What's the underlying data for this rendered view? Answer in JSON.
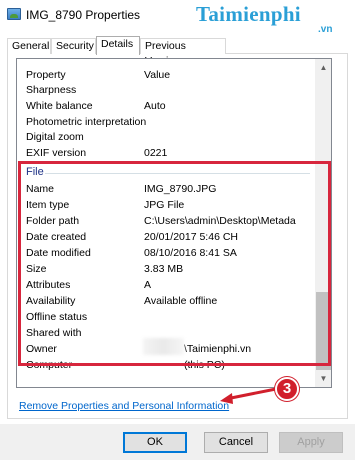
{
  "window": {
    "title": "IMG_8790 Properties",
    "watermark": "Taimienphi",
    "watermark_sub": ".vn"
  },
  "tabs": [
    {
      "label": "General"
    },
    {
      "label": "Security"
    },
    {
      "label": "Details",
      "active": true
    },
    {
      "label": "Previous Versions"
    }
  ],
  "details": {
    "header": {
      "property": "Property",
      "value": "Value"
    },
    "top_rows": [
      {
        "property": "Sharpness",
        "value": ""
      },
      {
        "property": "White balance",
        "value": "Auto"
      },
      {
        "property": "Photometric interpretation",
        "value": ""
      },
      {
        "property": "Digital zoom",
        "value": ""
      },
      {
        "property": "EXIF version",
        "value": "0221"
      }
    ],
    "section_file": "File",
    "file_rows": [
      {
        "property": "Name",
        "value": "IMG_8790.JPG"
      },
      {
        "property": "Item type",
        "value": "JPG File"
      },
      {
        "property": "Folder path",
        "value": "C:\\Users\\admin\\Desktop\\Metada"
      },
      {
        "property": "Date created",
        "value": "20/01/2017 5:46 CH"
      },
      {
        "property": "Date modified",
        "value": "08/10/2016 8:41 SA"
      },
      {
        "property": "Size",
        "value": "3.83 MB"
      },
      {
        "property": "Attributes",
        "value": "A"
      },
      {
        "property": "Availability",
        "value": "Available offline"
      },
      {
        "property": "Offline status",
        "value": ""
      },
      {
        "property": "Shared with",
        "value": ""
      },
      {
        "property": "Owner",
        "value": "\\Taimienphi.vn"
      },
      {
        "property": "Computer",
        "value": "(this PC)"
      }
    ]
  },
  "link": {
    "label": "Remove Properties and Personal Information"
  },
  "callout": {
    "number": "3"
  },
  "buttons": {
    "ok": "OK",
    "cancel": "Cancel",
    "apply": "Apply"
  },
  "colors": {
    "highlight": "#d7263d",
    "link": "#0066cc",
    "watermark": "#2a9fd6"
  }
}
